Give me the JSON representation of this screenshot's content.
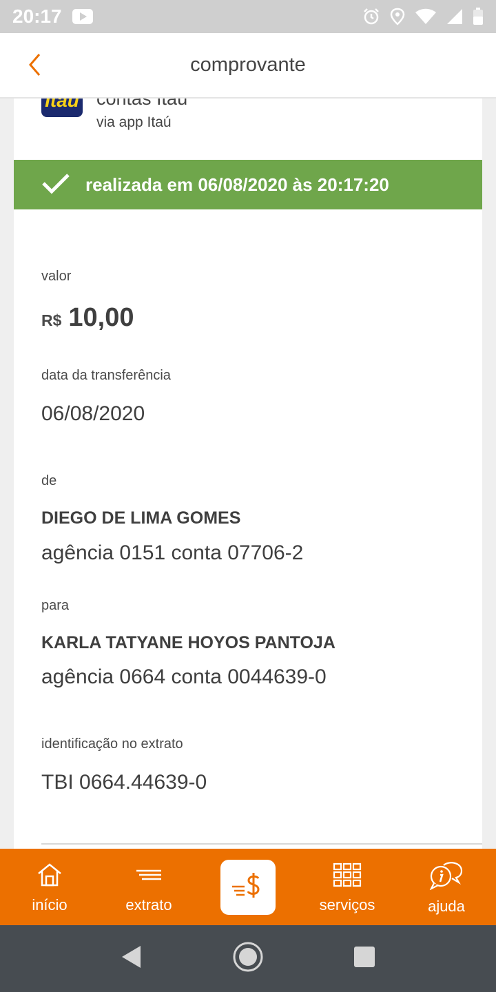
{
  "status_bar": {
    "time": "20:17",
    "icons": [
      "youtube-icon",
      "alarm-icon",
      "location-icon",
      "wifi-icon",
      "signal-icon",
      "battery-icon"
    ]
  },
  "app_bar": {
    "title": "comprovante",
    "back_icon": "chevron-left-icon"
  },
  "receipt": {
    "logo_text": "Itaú",
    "origin_title": "contas Itaú",
    "origin_subtitle": "via app Itaú",
    "success_text": "realizada em 06/08/2020 às 20:17:20",
    "amount_label": "valor",
    "currency": "R$",
    "amount": "10,00",
    "date_label": "data da transferência",
    "date": "06/08/2020",
    "from_label": "de",
    "from_name": "DIEGO DE LIMA GOMES",
    "from_account": "agência 0151 conta 07706-2",
    "to_label": "para",
    "to_name": "KARLA TATYANE HOYOS PANTOJA",
    "to_account": "agência 0664 conta 0044639-0",
    "statement_label": "identificação no extrato",
    "statement_id": "TBI 0664.44639-0"
  },
  "bottom_nav": {
    "items": [
      {
        "label": "início",
        "icon": "home-icon"
      },
      {
        "label": "extrato",
        "icon": "statement-icon"
      },
      {
        "label": "",
        "icon": "pay-icon"
      },
      {
        "label": "serviços",
        "icon": "grid-icon"
      },
      {
        "label": "ajuda",
        "icon": "help-chat-icon"
      }
    ]
  },
  "colors": {
    "accent": "#ec7000",
    "success": "#6fa64b",
    "logo_bg": "#1b2a6e",
    "logo_text": "#f7d117",
    "system_nav": "#474c51"
  }
}
